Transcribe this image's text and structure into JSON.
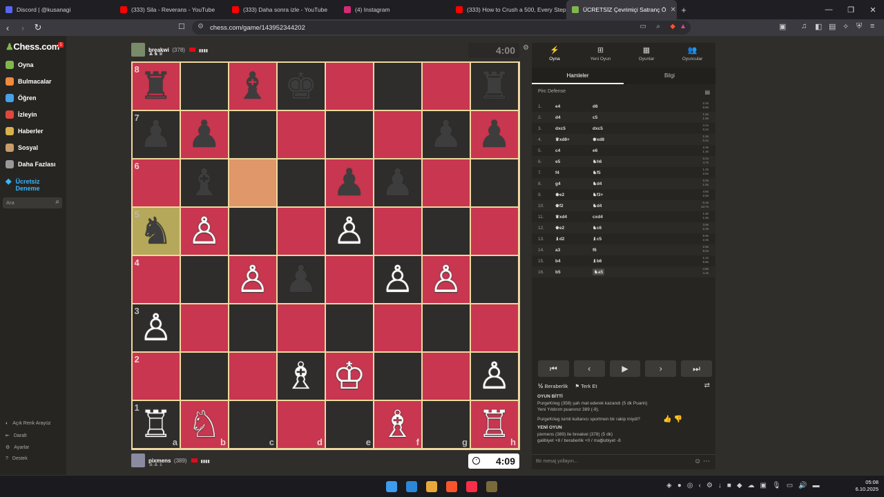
{
  "browser": {
    "tabs": [
      {
        "label": "Discord | @kusanagi",
        "color": "#5865f2",
        "active": false
      },
      {
        "label": "(333) Sila - Reverans - YouTube",
        "color": "#ff0000",
        "active": false
      },
      {
        "label": "(333) Daha sonra izle - YouTube",
        "color": "#ff0000",
        "active": false
      },
      {
        "label": "(4) Instagram",
        "color": "#d62976",
        "active": false
      },
      {
        "label": "(333) How to Crush a 500, Every Step",
        "color": "#ff0000",
        "active": false
      },
      {
        "label": "ÜCRETSİZ Çevrimiçi Satranç Ö",
        "color": "#81b64c",
        "active": true
      }
    ],
    "url": "chess.com/game/143952344202"
  },
  "sidebar": {
    "logo": "Chess.com",
    "notif_count": "1",
    "items": [
      {
        "label": "Oyna",
        "color": "#81b64c"
      },
      {
        "label": "Bulmacalar",
        "color": "#f08a3c"
      },
      {
        "label": "Öğren",
        "color": "#45a1e8"
      },
      {
        "label": "İzleyin",
        "color": "#e0473c"
      },
      {
        "label": "Haberler",
        "color": "#d9b04b"
      },
      {
        "label": "Sosyal",
        "color": "#c99b6a"
      },
      {
        "label": "Daha Fazlası",
        "color": "#999999"
      }
    ],
    "trial_line1": "Ücretsiz",
    "trial_line2": "Deneme",
    "search_placeholder": "Ara",
    "bottom": [
      {
        "label": "Açık Renk Arayüz",
        "icon": "◐"
      },
      {
        "label": "Daralt",
        "icon": "⇤"
      },
      {
        "label": "Ayarlar",
        "icon": "⚙"
      },
      {
        "label": "Destek",
        "icon": "?"
      }
    ]
  },
  "top_player": {
    "name": "breakwi",
    "rating": "(378)",
    "clock": "4:00",
    "captured": "♟♞♛"
  },
  "bottom_player": {
    "name": "pixmens",
    "rating": "(389)",
    "clock": "4:09",
    "captured": "♟♟♝"
  },
  "board": {
    "light_color": "#c8364f",
    "dark_color": "#2e2d2b",
    "border_color": "#f0d9a0",
    "files": [
      "a",
      "b",
      "c",
      "d",
      "e",
      "f",
      "g",
      "h"
    ],
    "ranks": [
      "8",
      "7",
      "6",
      "5",
      "4",
      "3",
      "2",
      "1"
    ],
    "pieces": [
      {
        "sq": "a8",
        "p": "♜",
        "c": "b"
      },
      {
        "sq": "c8",
        "p": "♝",
        "c": "b"
      },
      {
        "sq": "d8",
        "p": "♚",
        "c": "b"
      },
      {
        "sq": "h8",
        "p": "♜",
        "c": "b"
      },
      {
        "sq": "a7",
        "p": "♟",
        "c": "b"
      },
      {
        "sq": "b7",
        "p": "♟",
        "c": "b"
      },
      {
        "sq": "g7",
        "p": "♟",
        "c": "b"
      },
      {
        "sq": "h7",
        "p": "♟",
        "c": "b"
      },
      {
        "sq": "b6",
        "p": "♝",
        "c": "b"
      },
      {
        "sq": "e6",
        "p": "♟",
        "c": "b"
      },
      {
        "sq": "f6",
        "p": "♟",
        "c": "b"
      },
      {
        "sq": "a5",
        "p": "♞",
        "c": "b"
      },
      {
        "sq": "b5",
        "p": "♙",
        "c": "w"
      },
      {
        "sq": "e5",
        "p": "♙",
        "c": "w"
      },
      {
        "sq": "c4",
        "p": "♙",
        "c": "w"
      },
      {
        "sq": "d4",
        "p": "♟",
        "c": "b"
      },
      {
        "sq": "f4",
        "p": "♙",
        "c": "w"
      },
      {
        "sq": "g4",
        "p": "♙",
        "c": "w"
      },
      {
        "sq": "a3",
        "p": "♙",
        "c": "w"
      },
      {
        "sq": "d2",
        "p": "♗",
        "c": "w"
      },
      {
        "sq": "e2",
        "p": "♔",
        "c": "w"
      },
      {
        "sq": "h2",
        "p": "♙",
        "c": "w"
      },
      {
        "sq": "a1",
        "p": "♖",
        "c": "w"
      },
      {
        "sq": "b1",
        "p": "♘",
        "c": "w"
      },
      {
        "sq": "f1",
        "p": "♗",
        "c": "w"
      },
      {
        "sq": "h1",
        "p": "♖",
        "c": "w"
      }
    ],
    "highlights": [
      {
        "sq": "c6",
        "color": "#e0976a"
      },
      {
        "sq": "a5",
        "color": "#b5a85a"
      }
    ]
  },
  "panel": {
    "tabs": [
      {
        "label": "Oyna",
        "glyph": "⚡"
      },
      {
        "label": "Yeni Oyun",
        "glyph": "⊞"
      },
      {
        "label": "Oyunlar",
        "glyph": "▦"
      },
      {
        "label": "Oyuncular",
        "glyph": "👥"
      }
    ],
    "subtabs": [
      "Hamleler",
      "Bilgi"
    ],
    "opening": "Pirc Defense",
    "moves": [
      {
        "n": "1.",
        "w": "e4",
        "b": "d6",
        "tw": "2.2s",
        "tb": "6.8s"
      },
      {
        "n": "2.",
        "w": "d4",
        "b": "c5",
        "tw": "1.6s",
        "tb": "1.9s"
      },
      {
        "n": "3.",
        "w": "dxc5",
        "b": "dxc5",
        "tw": "4.1s",
        "tb": "0.1s"
      },
      {
        "n": "4.",
        "w": "♛xd8+",
        "b": "♚xd8",
        "tw": "1.5s",
        "tb": "0.1s"
      },
      {
        "n": "5.",
        "w": "c4",
        "b": "e6",
        "tw": "2.3s",
        "tb": "1.4s"
      },
      {
        "n": "6.",
        "w": "e5",
        "b": "♞h6",
        "tw": "3.1s",
        "tb": "4.7s"
      },
      {
        "n": "7.",
        "w": "f4",
        "b": "♞f5",
        "tw": "1.2s",
        "tb": "2.5s"
      },
      {
        "n": "8.",
        "w": "g4",
        "b": "♞d4",
        "tw": "2.0s",
        "tb": "1.5s"
      },
      {
        "n": "9.",
        "w": "♚e2",
        "b": "♞f3+",
        "tw": "4.8s",
        "tb": "2.0s"
      },
      {
        "n": "10.",
        "w": "♚f2",
        "b": "♞d4",
        "tw": "6.4s",
        "tb": "13.7s"
      },
      {
        "n": "11.",
        "w": "♛xd4",
        "b": "cxd4",
        "tw": "1.8s",
        "tb": "1.8s"
      },
      {
        "n": "12.",
        "w": "♚e2",
        "b": "♞c6",
        "tw": "3.9s",
        "tb": "2.3s"
      },
      {
        "n": "13.",
        "w": "♝d2",
        "b": "♝c5",
        "tw": "5.8s",
        "tb": "2.3s"
      },
      {
        "n": "14.",
        "w": "a3",
        "b": "f6",
        "tw": "2.5s",
        "tb": "9.0s"
      },
      {
        "n": "15.",
        "w": "b4",
        "b": "♝b6",
        "tw": "1.1s",
        "tb": "5.8s"
      },
      {
        "n": "16.",
        "w": "b5",
        "b": "♞a5",
        "tw": "4.8s",
        "tb": "4.4s"
      }
    ],
    "nav_buttons": [
      "⏮",
      "‹",
      "▶",
      "›",
      "⏭"
    ],
    "draw_label": "Beraberlik",
    "resign_label": "Terk Et",
    "chat": {
      "line0": "OYUN BİTTİ",
      "line1": "PurgeKrieg (358) şah mat ederek kazandı (5 dk Puanlı)",
      "line2": "Yeni Yıldırım puanınız 389 (-9).",
      "question": "PurgeKrieg isimli kullanıcı sportmen bir rakip miydi?",
      "new_game": "YENİ OYUN",
      "line3": "pixmens (389) ile breakwi (378) (5 dk)",
      "line4": "galibiyet +8 / beraberlik +0 / mağlubiyet -8"
    },
    "message_placeholder": "Bir mesaj yollayın..."
  },
  "taskbar": {
    "time": "05:08",
    "date": "6.10.2025",
    "apps": [
      {
        "color": "#0f6cbd"
      },
      {
        "color": "#2b88d8"
      },
      {
        "color": "#e8a93a"
      },
      {
        "color": "#fb542b"
      },
      {
        "color": "#fa2d48"
      },
      {
        "color": "#7a6a3a"
      }
    ]
  }
}
